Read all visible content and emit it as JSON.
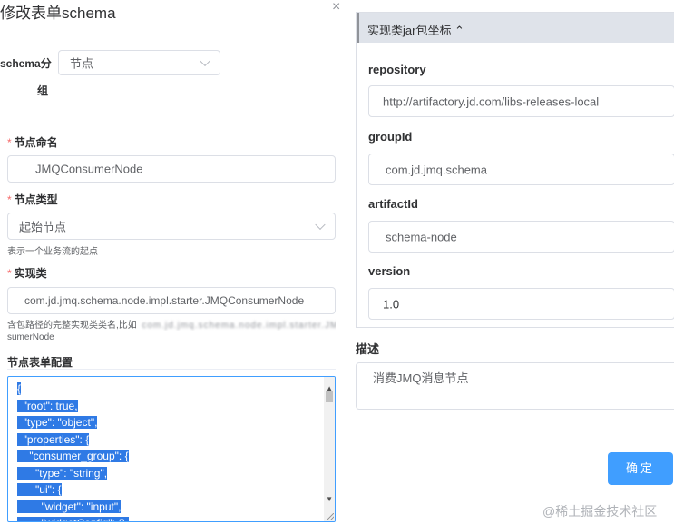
{
  "dialog": {
    "title": "修改表单schema",
    "close_glyph": "×"
  },
  "group": {
    "label_line1": "schema分",
    "label_line2": "组",
    "value": "节点"
  },
  "node_name": {
    "required_mark": "*",
    "label": "节点命名",
    "value": "JMQConsumerNode"
  },
  "node_type": {
    "required_mark": "*",
    "label": "节点类型",
    "value": "起始节点",
    "hint": "表示一个业务流的起点"
  },
  "impl_class": {
    "required_mark": "*",
    "label": "实现类",
    "value": "com.jd.jmq.schema.node.impl.starter.JMQConsumerNode",
    "hint_prefix": "含包路径的完整实现类类名,比如",
    "hint_example": "com.jd.jmq.schema.node.impl.starter.JMQCon",
    "hint_line2": "sumerNode"
  },
  "form_config": {
    "label": "节点表单配置",
    "lines": [
      "{",
      "  \"root\": true,",
      "  \"type\": \"object\",",
      "  \"properties\": {",
      "    \"consumer_group\": {",
      "      \"type\": \"string\",",
      "      \"ui\": {",
      "        \"widget\": \"input\",",
      "        \"widgetConfig\": {},"
    ]
  },
  "jar": {
    "header": "实现类jar包坐标 ⌃",
    "repository_label": "repository",
    "repository_value": "http://artifactory.jd.com/libs-releases-local",
    "groupid_label": "groupId",
    "groupid_value": "com.jd.jmq.schema",
    "artifactid_label": "artifactId",
    "artifactid_value": "schema-node",
    "version_label": "version",
    "version_value": "1.0"
  },
  "description": {
    "label": "描述",
    "value": "消费JMQ消息节点"
  },
  "confirm_label": "确定",
  "watermark": "@稀土掘金技术社区"
}
